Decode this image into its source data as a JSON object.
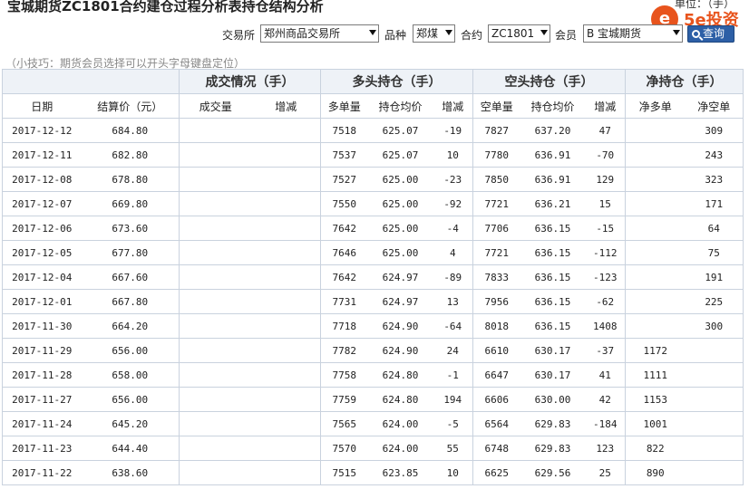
{
  "header": {
    "title": "宝城期货ZC1801合约建仓过程分析表持仓结构分析",
    "unit": "单位：（手）"
  },
  "logo": {
    "symbol": "e",
    "text": "5e投资"
  },
  "filters": {
    "exchange_label": "交易所",
    "exchange_value": "郑州商品交易所",
    "variety_label": "品种",
    "variety_value": "郑煤",
    "contract_label": "合约",
    "contract_value": "ZC1801",
    "member_label": "会员",
    "member_value": "B 宝城期货",
    "query_label": "查询"
  },
  "tip": "（小技巧：期货会员选择可以开头字母键盘定位）",
  "table": {
    "groups": {
      "trade": "成交情况（手）",
      "long": "多头持仓（手）",
      "short": "空头持仓（手）",
      "net": "净持仓（手）"
    },
    "columns": {
      "date": "日期",
      "settle": "结算价（元）",
      "volume": "成交量",
      "vol_change": "增减",
      "long_qty": "多单量",
      "long_avg": "持仓均价",
      "long_change": "增减",
      "short_qty": "空单量",
      "short_avg": "持仓均价",
      "short_change": "增减",
      "net_long": "净多单",
      "net_short": "净空单"
    },
    "rows": [
      {
        "date": "2017-12-12",
        "settle": "684.80",
        "vol": "",
        "vol_chg": "",
        "long_qty": "7518",
        "long_avg": "625.07",
        "long_chg": "-19",
        "short_qty": "7827",
        "short_avg": "637.20",
        "short_chg": "47",
        "net_long": "",
        "net_short": "309"
      },
      {
        "date": "2017-12-11",
        "settle": "682.80",
        "vol": "",
        "vol_chg": "",
        "long_qty": "7537",
        "long_avg": "625.07",
        "long_chg": "10",
        "short_qty": "7780",
        "short_avg": "636.91",
        "short_chg": "-70",
        "net_long": "",
        "net_short": "243"
      },
      {
        "date": "2017-12-08",
        "settle": "678.80",
        "vol": "",
        "vol_chg": "",
        "long_qty": "7527",
        "long_avg": "625.00",
        "long_chg": "-23",
        "short_qty": "7850",
        "short_avg": "636.91",
        "short_chg": "129",
        "net_long": "",
        "net_short": "323"
      },
      {
        "date": "2017-12-07",
        "settle": "669.80",
        "vol": "",
        "vol_chg": "",
        "long_qty": "7550",
        "long_avg": "625.00",
        "long_chg": "-92",
        "short_qty": "7721",
        "short_avg": "636.21",
        "short_chg": "15",
        "net_long": "",
        "net_short": "171"
      },
      {
        "date": "2017-12-06",
        "settle": "673.60",
        "vol": "",
        "vol_chg": "",
        "long_qty": "7642",
        "long_avg": "625.00",
        "long_chg": "-4",
        "short_qty": "7706",
        "short_avg": "636.15",
        "short_chg": "-15",
        "net_long": "",
        "net_short": "64"
      },
      {
        "date": "2017-12-05",
        "settle": "677.80",
        "vol": "",
        "vol_chg": "",
        "long_qty": "7646",
        "long_avg": "625.00",
        "long_chg": "4",
        "short_qty": "7721",
        "short_avg": "636.15",
        "short_chg": "-112",
        "net_long": "",
        "net_short": "75"
      },
      {
        "date": "2017-12-04",
        "settle": "667.60",
        "vol": "",
        "vol_chg": "",
        "long_qty": "7642",
        "long_avg": "624.97",
        "long_chg": "-89",
        "short_qty": "7833",
        "short_avg": "636.15",
        "short_chg": "-123",
        "net_long": "",
        "net_short": "191"
      },
      {
        "date": "2017-12-01",
        "settle": "667.80",
        "vol": "",
        "vol_chg": "",
        "long_qty": "7731",
        "long_avg": "624.97",
        "long_chg": "13",
        "short_qty": "7956",
        "short_avg": "636.15",
        "short_chg": "-62",
        "net_long": "",
        "net_short": "225"
      },
      {
        "date": "2017-11-30",
        "settle": "664.20",
        "vol": "",
        "vol_chg": "",
        "long_qty": "7718",
        "long_avg": "624.90",
        "long_chg": "-64",
        "short_qty": "8018",
        "short_avg": "636.15",
        "short_chg": "1408",
        "net_long": "",
        "net_short": "300"
      },
      {
        "date": "2017-11-29",
        "settle": "656.00",
        "vol": "",
        "vol_chg": "",
        "long_qty": "7782",
        "long_avg": "624.90",
        "long_chg": "24",
        "short_qty": "6610",
        "short_avg": "630.17",
        "short_chg": "-37",
        "net_long": "1172",
        "net_short": ""
      },
      {
        "date": "2017-11-28",
        "settle": "658.00",
        "vol": "",
        "vol_chg": "",
        "long_qty": "7758",
        "long_avg": "624.80",
        "long_chg": "-1",
        "short_qty": "6647",
        "short_avg": "630.17",
        "short_chg": "41",
        "net_long": "1111",
        "net_short": ""
      },
      {
        "date": "2017-11-27",
        "settle": "656.00",
        "vol": "",
        "vol_chg": "",
        "long_qty": "7759",
        "long_avg": "624.80",
        "long_chg": "194",
        "short_qty": "6606",
        "short_avg": "630.00",
        "short_chg": "42",
        "net_long": "1153",
        "net_short": ""
      },
      {
        "date": "2017-11-24",
        "settle": "645.20",
        "vol": "",
        "vol_chg": "",
        "long_qty": "7565",
        "long_avg": "624.00",
        "long_chg": "-5",
        "short_qty": "6564",
        "short_avg": "629.83",
        "short_chg": "-184",
        "net_long": "1001",
        "net_short": ""
      },
      {
        "date": "2017-11-23",
        "settle": "644.40",
        "vol": "",
        "vol_chg": "",
        "long_qty": "7570",
        "long_avg": "624.00",
        "long_chg": "55",
        "short_qty": "6748",
        "short_avg": "629.83",
        "short_chg": "123",
        "net_long": "822",
        "net_short": ""
      },
      {
        "date": "2017-11-22",
        "settle": "638.60",
        "vol": "",
        "vol_chg": "",
        "long_qty": "7515",
        "long_avg": "623.85",
        "long_chg": "10",
        "short_qty": "6625",
        "short_avg": "629.56",
        "short_chg": "25",
        "net_long": "890",
        "net_short": ""
      }
    ]
  },
  "colors": {
    "increase": "#d40000",
    "decrease": "#009900",
    "accent": "#2d5fa6",
    "brand": "#e8541d"
  }
}
